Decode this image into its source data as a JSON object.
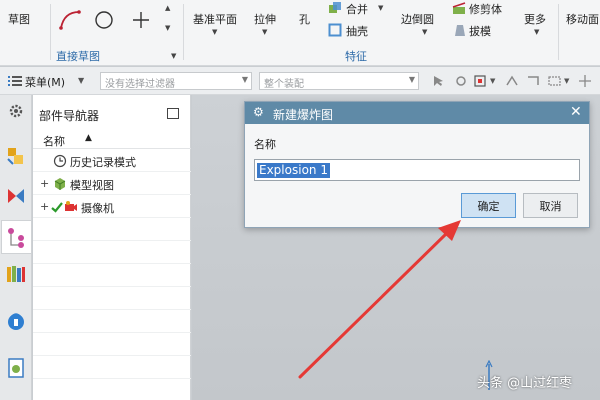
{
  "ribbon": {
    "sketch_label": "草图",
    "datum_plane_label": "基准平面",
    "extrude_label": "拉伸",
    "hole_label": "孔",
    "unite_label": "合并",
    "shell_label": "抽壳",
    "edge_blend_label": "边倒圆",
    "trim_body_label": "修剪体",
    "draft_label": "拔模",
    "more_label": "更多",
    "move_face_label": "移动面",
    "group_direct_sketch": "直接草图",
    "group_feature": "特征"
  },
  "toolbar": {
    "menu_label": "菜单(M)",
    "selection_filter_placeholder": "没有选择过滤器",
    "assembly_scope": "整个装配"
  },
  "navigator": {
    "title": "部件导航器",
    "column_name": "名称",
    "items": [
      {
        "label": "历史记录模式"
      },
      {
        "label": "模型视图"
      },
      {
        "label": "摄像机"
      }
    ]
  },
  "dialog": {
    "title": "新建爆炸图",
    "name_label": "名称",
    "name_value": "Explosion 1",
    "ok_label": "确定",
    "cancel_label": "取消"
  },
  "watermark": "头条 @山过红枣",
  "colors": {
    "dialog_titlebar": "#5f8aa7",
    "annotation_arrow": "#e53935",
    "ok_button": "#cfe2f3"
  }
}
